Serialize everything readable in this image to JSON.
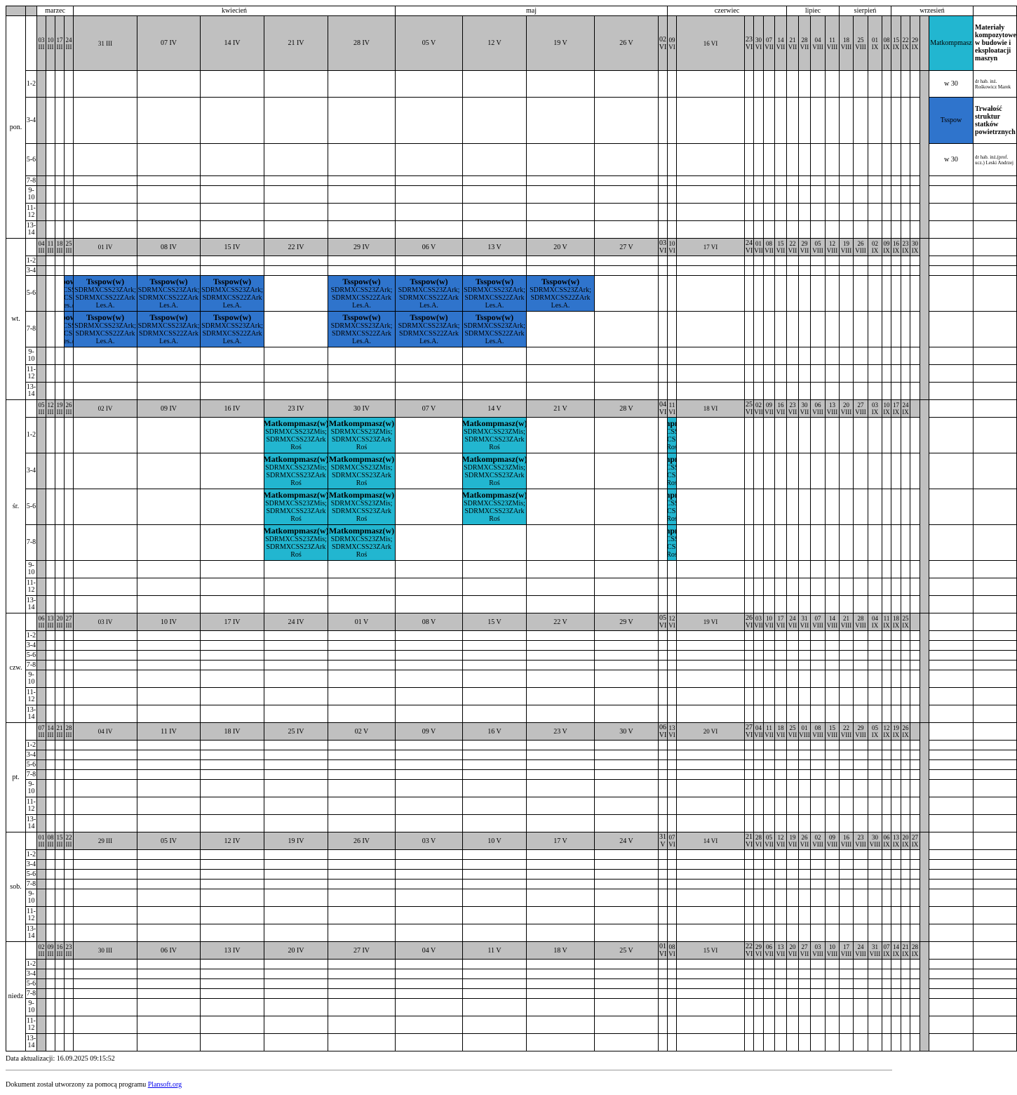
{
  "months": [
    "marzec",
    "kwiecień",
    "maj",
    "czerwiec",
    "lipiec",
    "sierpień",
    "wrzesień"
  ],
  "days": [
    "pon.",
    "wt.",
    "śr.",
    "czw.",
    "pt.",
    "sob.",
    "niedz"
  ],
  "slots": [
    "1-2",
    "3-4",
    "5-6",
    "7-8",
    "9-10",
    "11-12",
    "13-14"
  ],
  "date_rows": [
    [
      "03 III",
      "10 III",
      "17 III",
      "24 III",
      "31 III",
      "07 IV",
      "14 IV",
      "21 IV",
      "28 IV",
      "05 V",
      "12 V",
      "19 V",
      "26 V",
      "02 VI",
      "09 VI",
      "16 VI",
      "23 VI",
      "30 VI",
      "07 VII",
      "14 VII",
      "21 VII",
      "28 VII",
      "04 VIII",
      "11 VIII",
      "18 VIII",
      "25 VIII",
      "01 IX",
      "08 IX",
      "15 IX",
      "22 IX",
      "29 IX"
    ],
    [
      "04 III",
      "11 III",
      "18 III",
      "25 III",
      "01 IV",
      "08 IV",
      "15 IV",
      "22 IV",
      "29 IV",
      "06 V",
      "13 V",
      "20 V",
      "27 V",
      "03 VI",
      "10 VI",
      "17 VI",
      "24 VI",
      "01 VII",
      "08 VII",
      "15 VII",
      "22 VII",
      "29 VII",
      "05 VIII",
      "12 VIII",
      "19 VIII",
      "26 VIII",
      "02 IX",
      "09 IX",
      "16 IX",
      "23 IX",
      "30 IX"
    ],
    [
      "05 III",
      "12 III",
      "19 III",
      "26 III",
      "02 IV",
      "09 IV",
      "16 IV",
      "23 IV",
      "30 IV",
      "07 V",
      "14 V",
      "21 V",
      "28 V",
      "04 VI",
      "11 VI",
      "18 VI",
      "25 VI",
      "02 VII",
      "09 VII",
      "16 VII",
      "23 VII",
      "30 VII",
      "06 VIII",
      "13 VIII",
      "20 VIII",
      "27 VIII",
      "03 IX",
      "10 IX",
      "17 IX",
      "24 IX",
      ""
    ],
    [
      "06 III",
      "13 III",
      "20 III",
      "27 III",
      "03 IV",
      "10 IV",
      "17 IV",
      "24 IV",
      "01 V",
      "08 V",
      "15 V",
      "22 V",
      "29 V",
      "05 VI",
      "12 VI",
      "19 VI",
      "26 VI",
      "03 VII",
      "10 VII",
      "17 VII",
      "24 VII",
      "31 VII",
      "07 VIII",
      "14 VIII",
      "21 VIII",
      "28 VIII",
      "04 IX",
      "11 IX",
      "18 IX",
      "25 IX",
      ""
    ],
    [
      "07 III",
      "14 III",
      "21 III",
      "28 III",
      "04 IV",
      "11 IV",
      "18 IV",
      "25 IV",
      "02 V",
      "09 V",
      "16 V",
      "23 V",
      "30 V",
      "06 VI",
      "13 VI",
      "20 VI",
      "27 VI",
      "04 VII",
      "11 VII",
      "18 VII",
      "25 VII",
      "01 VIII",
      "08 VIII",
      "15 VIII",
      "22 VIII",
      "29 VIII",
      "05 IX",
      "12 IX",
      "19 IX",
      "26 IX",
      ""
    ],
    [
      "01 III",
      "08 III",
      "15 III",
      "22 III",
      "29 III",
      "05 IV",
      "12 IV",
      "19 IV",
      "26 IV",
      "03 V",
      "10 V",
      "17 V",
      "24 V",
      "31 V",
      "07 VI",
      "14 VI",
      "21 VI",
      "28 VI",
      "05 VII",
      "12 VII",
      "19 VII",
      "26 VII",
      "02 VIII",
      "09 VIII",
      "16 VIII",
      "23 VIII",
      "30 VIII",
      "06 IX",
      "13 IX",
      "20 IX",
      "27 IX"
    ],
    [
      "02 III",
      "09 III",
      "16 III",
      "23 III",
      "30 III",
      "06 IV",
      "13 IV",
      "20 IV",
      "27 IV",
      "04 V",
      "11 V",
      "18 V",
      "25 V",
      "01 VI",
      "08 VI",
      "15 VI",
      "22 VI",
      "29 VI",
      "06 VII",
      "13 VII",
      "20 VII",
      "27 VII",
      "03 VIII",
      "10 VIII",
      "17 VIII",
      "24 VIII",
      "31 VIII",
      "07 IX",
      "14 IX",
      "21 IX",
      "28 IX"
    ]
  ],
  "tsspow": {
    "title": "Tsspow(w)",
    "group1": "SDRMXCSS23ZArk;",
    "group2": "SDRMXCSS22ZArk",
    "teacher": "Les.A."
  },
  "matk": {
    "title": "Matkompmasz(w)",
    "group1": "SDRMXCSS23ZMis;",
    "group2": "SDRMXCSS23ZArk",
    "teacher": "Roś"
  },
  "events": [
    {
      "type": "tsspow",
      "day": 1,
      "slot": 2,
      "cols": [
        3,
        4,
        5,
        6,
        8,
        9,
        10,
        11
      ]
    },
    {
      "type": "tsspow",
      "day": 1,
      "slot": 3,
      "cols": [
        3,
        4,
        5,
        6,
        8,
        9,
        10
      ]
    },
    {
      "type": "matk",
      "day": 2,
      "slot": 0,
      "cols": [
        7,
        8,
        10,
        14
      ]
    },
    {
      "type": "matk",
      "day": 2,
      "slot": 1,
      "cols": [
        7,
        8,
        10,
        14
      ]
    },
    {
      "type": "matk",
      "day": 2,
      "slot": 2,
      "cols": [
        7,
        8,
        10,
        14
      ]
    },
    {
      "type": "matk",
      "day": 2,
      "slot": 3,
      "cols": [
        7,
        8,
        14
      ]
    }
  ],
  "legend": {
    "matk_code": "Matkompmasz",
    "matk_name": "Materiały kompozytowe w budowie i eksploatacji maszyn",
    "matk_hours": "w 30",
    "matk_teacher": "dr hab. inż. Rośkowicz Marek",
    "tss_code": "Tsspow",
    "tss_name": "Trwałość struktur statków powietrznych",
    "tss_hours": "w 30",
    "tss_teacher": "dr hab. inż.(prof. ucz.) Leski Andrzej"
  },
  "colors": {
    "tsspow": "#2f74cc",
    "matk": "#22b6d0",
    "header": "#c0c0c0"
  },
  "footer": {
    "updated": "Data aktualizacji: 16.09.2025 09:15:52",
    "credit_prefix": "Dokument został utworzony za pomocą programu",
    "credit_link": "Plansoft.org"
  }
}
